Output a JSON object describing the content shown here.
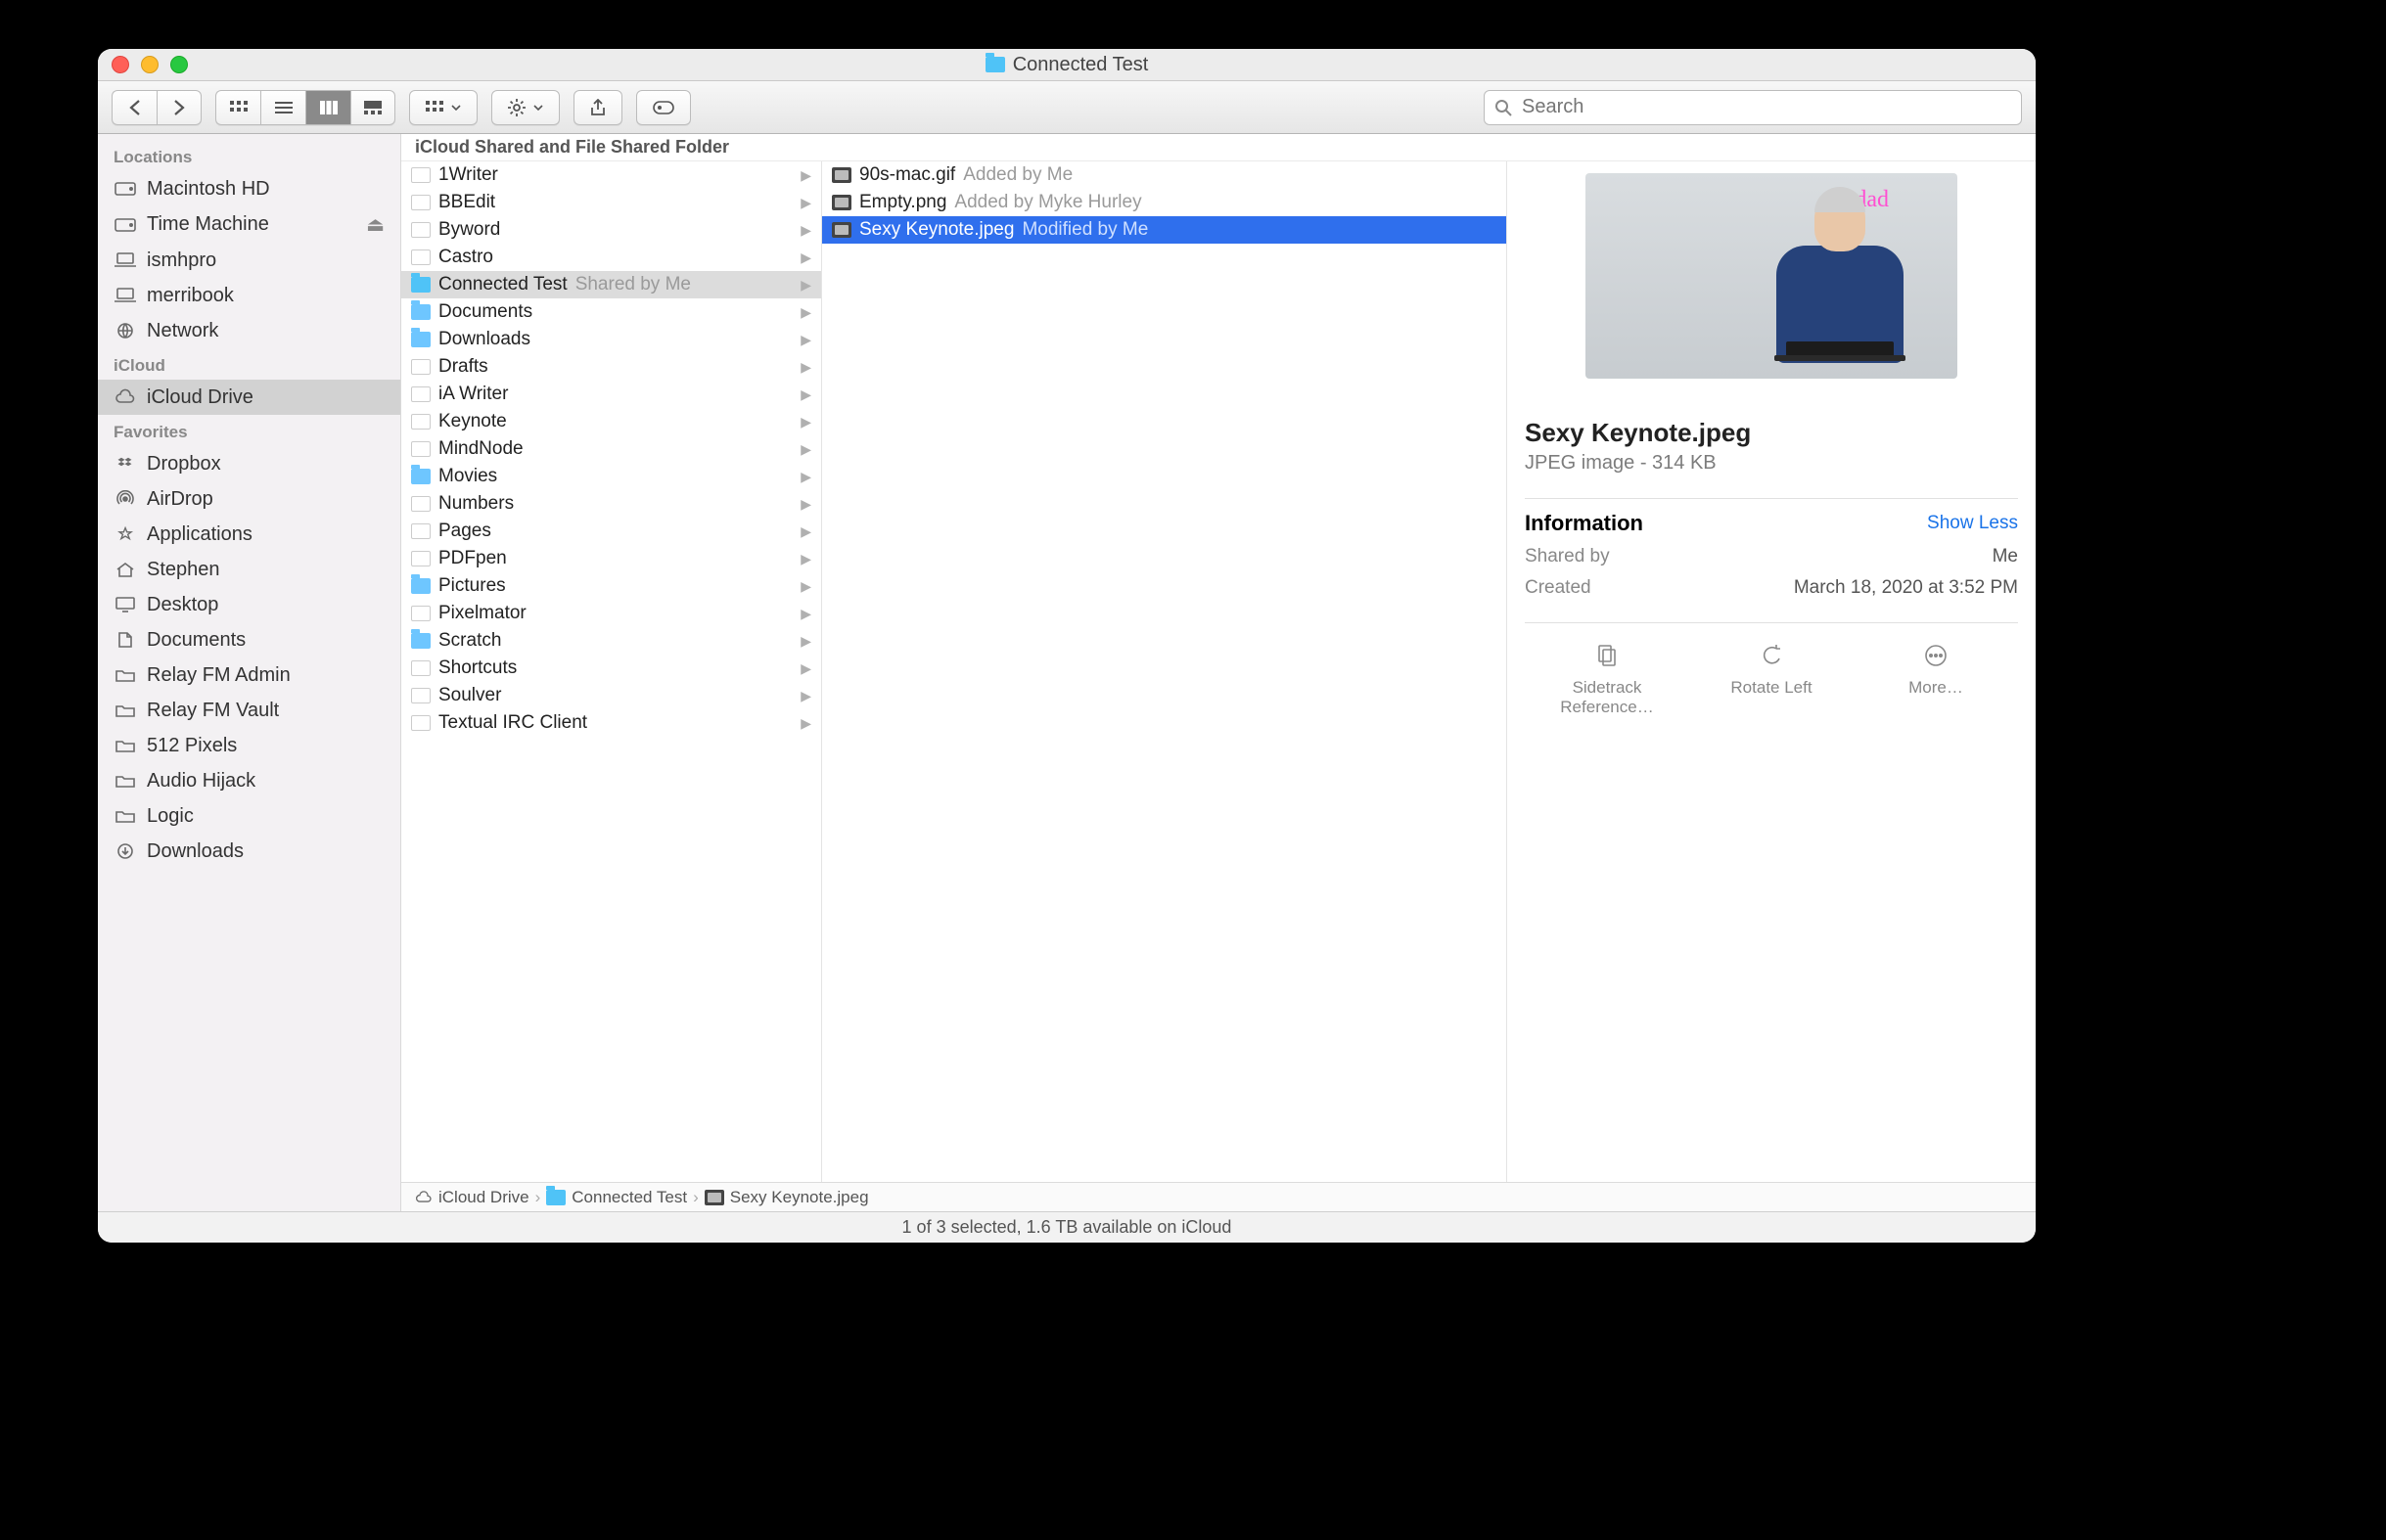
{
  "window": {
    "title": "Connected Test"
  },
  "toolbar": {
    "search_placeholder": "Search"
  },
  "sidebar": {
    "sections": [
      {
        "label": "Locations",
        "items": [
          {
            "name": "Macintosh HD",
            "icon": "hdd"
          },
          {
            "name": "Time Machine",
            "icon": "ext",
            "eject": true
          },
          {
            "name": "ismhpro",
            "icon": "laptop"
          },
          {
            "name": "merribook",
            "icon": "laptop"
          },
          {
            "name": "Network",
            "icon": "globe"
          }
        ]
      },
      {
        "label": "iCloud",
        "items": [
          {
            "name": "iCloud Drive",
            "icon": "cloud",
            "selected": true
          }
        ]
      },
      {
        "label": "Favorites",
        "items": [
          {
            "name": "Dropbox",
            "icon": "dropbox"
          },
          {
            "name": "AirDrop",
            "icon": "airdrop"
          },
          {
            "name": "Applications",
            "icon": "apps"
          },
          {
            "name": "Stephen",
            "icon": "home"
          },
          {
            "name": "Desktop",
            "icon": "desktop"
          },
          {
            "name": "Documents",
            "icon": "docs"
          },
          {
            "name": "Relay FM Admin",
            "icon": "folder"
          },
          {
            "name": "Relay FM Vault",
            "icon": "folder"
          },
          {
            "name": "512 Pixels",
            "icon": "folder"
          },
          {
            "name": "Audio Hijack",
            "icon": "folder"
          },
          {
            "name": "Logic",
            "icon": "folder"
          },
          {
            "name": "Downloads",
            "icon": "downloads"
          }
        ]
      }
    ]
  },
  "cols": {
    "header": "iCloud Shared and File Shared Folder",
    "col1": [
      {
        "name": "1Writer",
        "type": "app"
      },
      {
        "name": "BBEdit",
        "type": "app"
      },
      {
        "name": "Byword",
        "type": "app"
      },
      {
        "name": "Castro",
        "type": "app"
      },
      {
        "name": "Connected Test",
        "type": "folder-shared",
        "meta": "Shared by Me",
        "selected": true
      },
      {
        "name": "Documents",
        "type": "folder"
      },
      {
        "name": "Downloads",
        "type": "folder"
      },
      {
        "name": "Drafts",
        "type": "app"
      },
      {
        "name": "iA Writer",
        "type": "app"
      },
      {
        "name": "Keynote",
        "type": "app"
      },
      {
        "name": "MindNode",
        "type": "app"
      },
      {
        "name": "Movies",
        "type": "folder"
      },
      {
        "name": "Numbers",
        "type": "app"
      },
      {
        "name": "Pages",
        "type": "app"
      },
      {
        "name": "PDFpen",
        "type": "app"
      },
      {
        "name": "Pictures",
        "type": "folder"
      },
      {
        "name": "Pixelmator",
        "type": "app"
      },
      {
        "name": "Scratch",
        "type": "folder"
      },
      {
        "name": "Shortcuts",
        "type": "app"
      },
      {
        "name": "Soulver",
        "type": "app"
      },
      {
        "name": "Textual IRC Client",
        "type": "app"
      }
    ],
    "col2": [
      {
        "name": "90s-mac.gif",
        "type": "img",
        "meta": "Added by Me"
      },
      {
        "name": "Empty.png",
        "type": "img",
        "meta": "Added by Myke Hurley"
      },
      {
        "name": "Sexy Keynote.jpeg",
        "type": "img",
        "meta": "Modified by Me",
        "selected": true
      }
    ]
  },
  "preview": {
    "overlay_text": "hi dad",
    "title": "Sexy Keynote.jpeg",
    "subtitle": "JPEG image - 314 KB",
    "info_label": "Information",
    "show_less": "Show Less",
    "fields": [
      {
        "k": "Shared by",
        "v": "Me"
      },
      {
        "k": "Created",
        "v": "March 18, 2020 at 3:52 PM"
      }
    ],
    "actions": [
      {
        "label": "Sidetrack Reference…"
      },
      {
        "label": "Rotate Left"
      },
      {
        "label": "More…"
      }
    ]
  },
  "path": [
    {
      "name": "iCloud Drive",
      "icon": "cloud"
    },
    {
      "name": "Connected Test",
      "icon": "folder-shared"
    },
    {
      "name": "Sexy Keynote.jpeg",
      "icon": "img"
    }
  ],
  "status": "1 of 3 selected, 1.6 TB available on iCloud"
}
